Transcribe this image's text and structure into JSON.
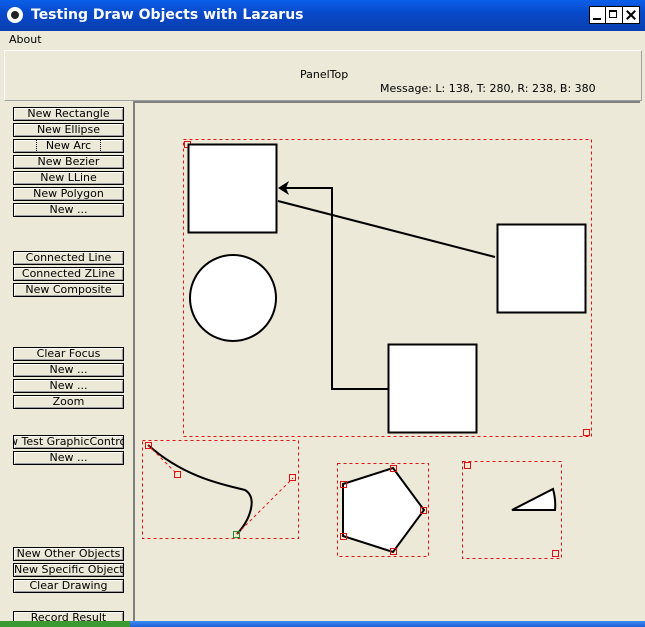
{
  "window": {
    "title": "Testing Draw Objects with Lazarus"
  },
  "menu": {
    "about": "About"
  },
  "panel_top": {
    "caption": "PanelTop",
    "message": "Message: L: 138, T: 280, R: 238, B: 380"
  },
  "buttons": {
    "new_rectangle": "New Rectangle",
    "new_ellipse": "New Ellipse",
    "new_arc": "New Arc",
    "new_bezier": "New Bezier",
    "new_lline": "New LLine",
    "new_polygon": "New Polygon",
    "new_more_1": "New ...",
    "connected_line": "Connected Line",
    "connected_zline": "Connected ZLine",
    "new_composite": "New Composite",
    "clear_focus": "Clear Focus",
    "new_more_2": "New ...",
    "new_more_3": "New ...",
    "zoom": "Zoom",
    "new_test_graphic_control": "New Test GraphicControl",
    "new_more_4": "New ...",
    "new_other_objects": "New Other Objects",
    "new_specific_objects": "New Specific Objects",
    "clear_drawing": "Clear Drawing",
    "record_result": "Record Result"
  },
  "colors": {
    "selection_dash": "#E01010",
    "shape_fill": "#FFFFFF",
    "shape_stroke": "#000000",
    "handle_green": "#2A8A2A"
  }
}
